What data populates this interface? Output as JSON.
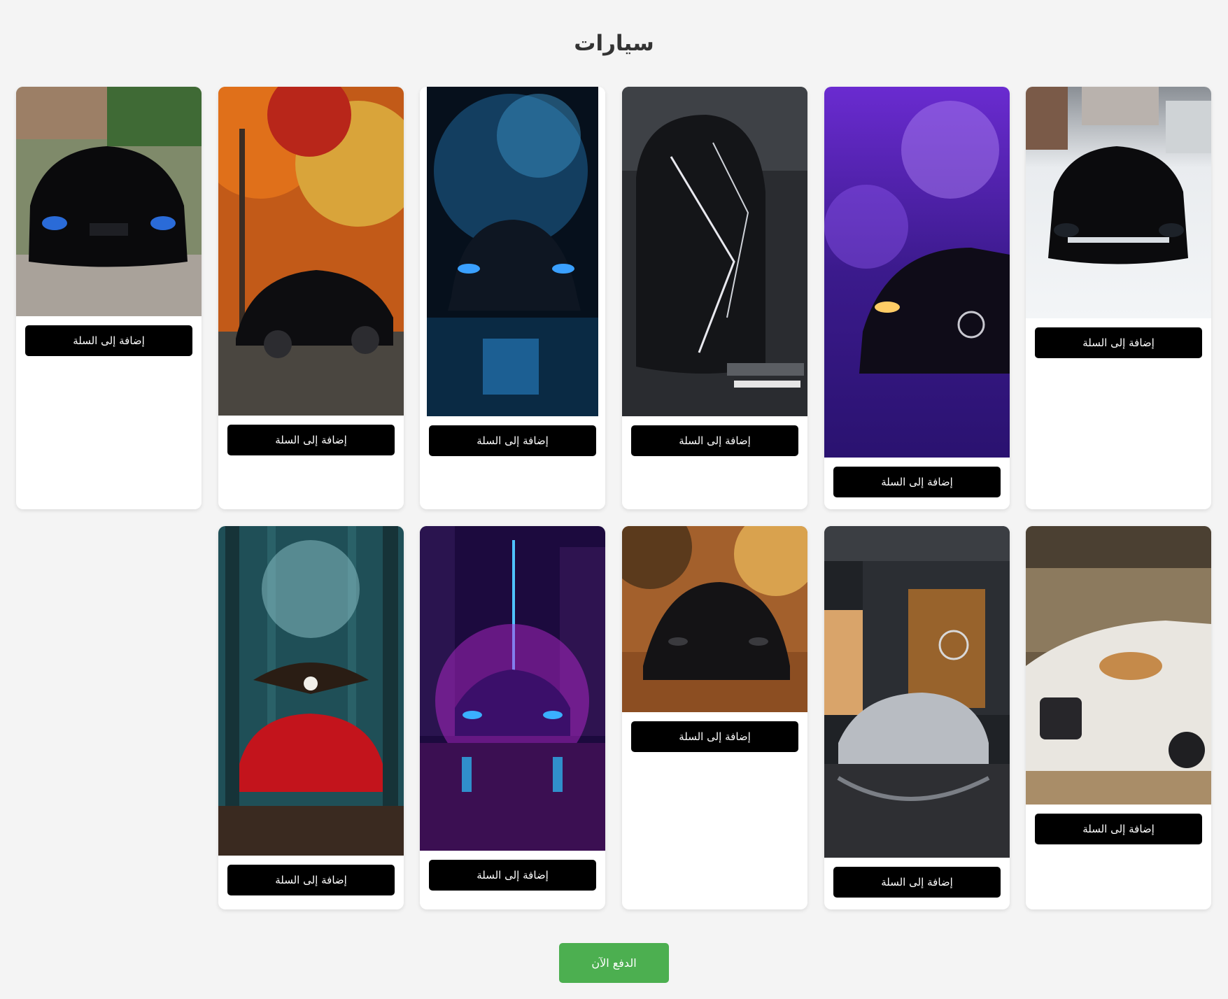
{
  "page": {
    "title": "سيارات"
  },
  "cards": [
    {
      "add_label": "إضافة إلى السلة",
      "image": "black mercedes in snow"
    },
    {
      "add_label": "إضافة إلى السلة",
      "image": "mercedes amg in purple forest"
    },
    {
      "add_label": "إضافة إلى السلة",
      "image": "chrome black bmw top view"
    },
    {
      "add_label": "إضافة إلى السلة",
      "image": "bmw in blue smoke"
    },
    {
      "add_label": "إضافة إلى السلة",
      "image": "black mercedes sedan autumn trees"
    },
    {
      "add_label": "إضافة إلى السلة",
      "image": "black bmw in front of house"
    },
    {
      "add_label": "إضافة إلى السلة",
      "image": "white bmw with cat"
    },
    {
      "add_label": "إضافة إلى السلة",
      "image": "silver mercedes amg gt at showroom"
    },
    {
      "add_label": "إضافة إلى السلة",
      "image": "black mercedes on autumn road"
    },
    {
      "add_label": "إضافة إلى السلة",
      "image": "neon purple lamborghini city"
    },
    {
      "add_label": "إضافة إلى السلة",
      "image": "red mercedes with eagle forest"
    }
  ],
  "checkout": {
    "pay_label": "الدفع الآن"
  },
  "colors": {
    "button": "#000000",
    "pay": "#4caf50",
    "background": "#f4f4f4"
  }
}
